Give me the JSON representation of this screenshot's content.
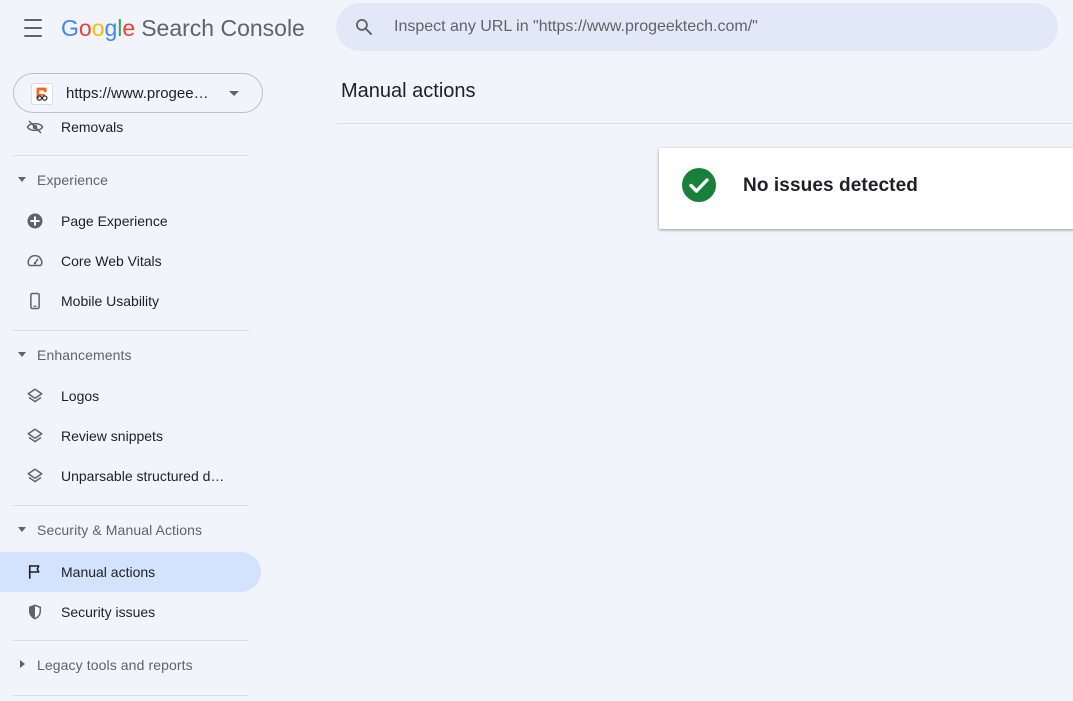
{
  "header": {
    "logo_letters": [
      "G",
      "o",
      "o",
      "g",
      "l",
      "e"
    ],
    "product_name": "Search Console",
    "search_placeholder": "Inspect any URL in \"https://www.progeektech.com/\""
  },
  "property": {
    "label": "https://www.progee…"
  },
  "sidebar": {
    "items": [
      {
        "label": "Removals",
        "icon": "removals-icon"
      },
      {
        "label": "Page Experience",
        "icon": "page-experience-icon"
      },
      {
        "label": "Core Web Vitals",
        "icon": "speedometer-icon"
      },
      {
        "label": "Mobile Usability",
        "icon": "phone-icon"
      },
      {
        "label": "Logos",
        "icon": "layers-icon"
      },
      {
        "label": "Review snippets",
        "icon": "layers-icon"
      },
      {
        "label": "Unparsable structured d…",
        "icon": "layers-icon"
      },
      {
        "label": "Manual actions",
        "icon": "flag-icon",
        "active": true
      },
      {
        "label": "Security issues",
        "icon": "shield-icon"
      }
    ],
    "sections": [
      {
        "label": "Experience",
        "expanded": true
      },
      {
        "label": "Enhancements",
        "expanded": true
      },
      {
        "label": "Security & Manual Actions",
        "expanded": true
      },
      {
        "label": "Legacy tools and reports",
        "expanded": false
      }
    ]
  },
  "main": {
    "title": "Manual actions",
    "status_text": "No issues detected",
    "status_color": "#188038"
  },
  "colors": {
    "background": "#f1f4fb",
    "active_nav": "#d3e3fd",
    "search_bg": "#e1e9f8"
  }
}
